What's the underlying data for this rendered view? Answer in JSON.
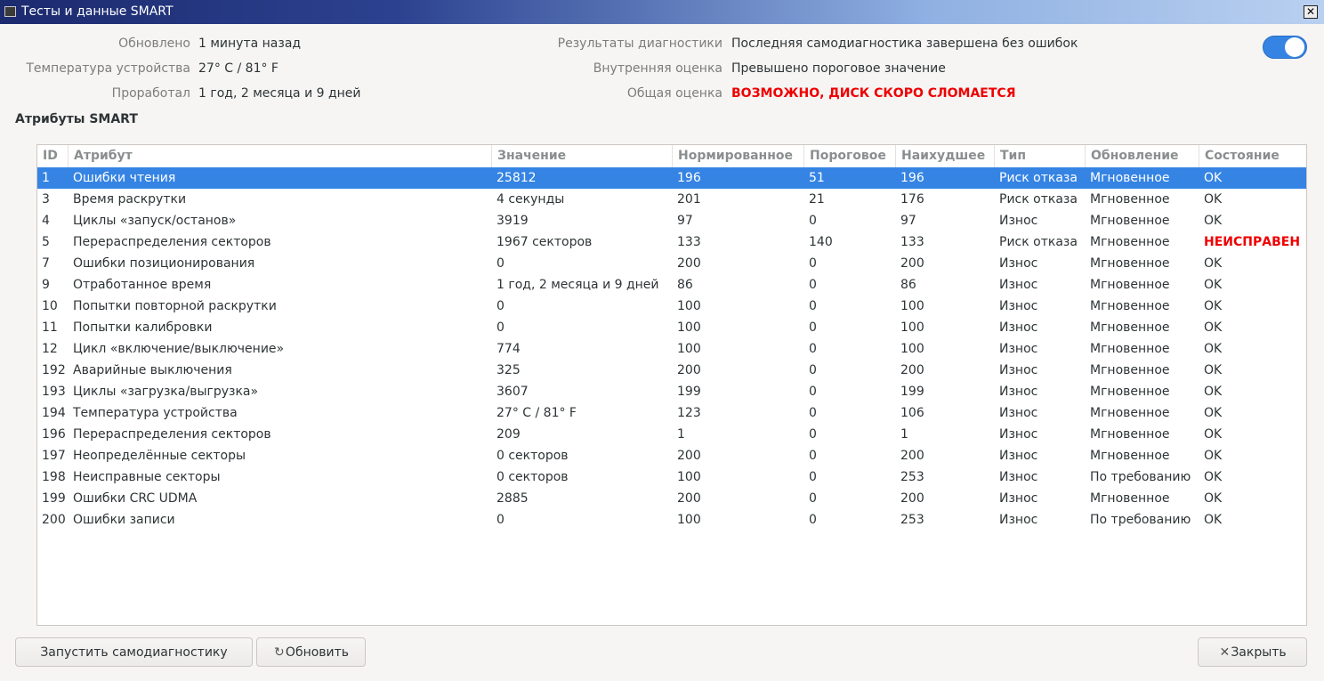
{
  "window": {
    "title": "Тесты и данные SMART",
    "close_glyph": "✕"
  },
  "info": {
    "updated_label": "Обновлено",
    "updated_value": "1 минута назад",
    "temp_label": "Температура устройства",
    "temp_value": "27° C / 81° F",
    "powered_label": "Проработал",
    "powered_value": "1 год, 2 месяца и 9 дней",
    "diag_label": "Результаты диагностики",
    "diag_value": "Последняя самодиагностика завершена без ошибок",
    "internal_label": "Внутренняя оценка",
    "internal_value": "Превышено пороговое значение",
    "overall_label": "Общая оценка",
    "overall_value": "ВОЗМОЖНО, ДИСК СКОРО СЛОМАЕТСЯ"
  },
  "smart_enabled": true,
  "section_title": "Атрибуты SMART",
  "table": {
    "headers": [
      "ID",
      "Атрибут",
      "Значение",
      "Нормированное",
      "Пороговое",
      "Наихудшее",
      "Тип",
      "Обновление",
      "Состояние"
    ],
    "rows": [
      [
        "1",
        "Ошибки чтения",
        "25812",
        "196",
        "51",
        "196",
        "Риск отказа",
        "Мгновенное",
        "OK"
      ],
      [
        "3",
        "Время раскрутки",
        "4 секунды",
        "201",
        "21",
        "176",
        "Риск отказа",
        "Мгновенное",
        "OK"
      ],
      [
        "4",
        "Циклы «запуск/останов»",
        "3919",
        "97",
        "0",
        "97",
        "Износ",
        "Мгновенное",
        "OK"
      ],
      [
        "5",
        "Перераспределения секторов",
        "1967 секторов",
        "133",
        "140",
        "133",
        "Риск отказа",
        "Мгновенное",
        "НЕИСПРАВЕН"
      ],
      [
        "7",
        "Ошибки позиционирования",
        "0",
        "200",
        "0",
        "200",
        "Износ",
        "Мгновенное",
        "OK"
      ],
      [
        "9",
        "Отработанное время",
        "1 год, 2 месяца и 9 дней",
        "86",
        "0",
        "86",
        "Износ",
        "Мгновенное",
        "OK"
      ],
      [
        "10",
        "Попытки повторной раскрутки",
        "0",
        "100",
        "0",
        "100",
        "Износ",
        "Мгновенное",
        "OK"
      ],
      [
        "11",
        "Попытки калибровки",
        "0",
        "100",
        "0",
        "100",
        "Износ",
        "Мгновенное",
        "OK"
      ],
      [
        "12",
        "Цикл «включение/выключение»",
        "774",
        "100",
        "0",
        "100",
        "Износ",
        "Мгновенное",
        "OK"
      ],
      [
        "192",
        "Аварийные выключения",
        "325",
        "200",
        "0",
        "200",
        "Износ",
        "Мгновенное",
        "OK"
      ],
      [
        "193",
        "Циклы «загрузка/выгрузка»",
        "3607",
        "199",
        "0",
        "199",
        "Износ",
        "Мгновенное",
        "OK"
      ],
      [
        "194",
        "Температура устройства",
        "27° C / 81° F",
        "123",
        "0",
        "106",
        "Износ",
        "Мгновенное",
        "OK"
      ],
      [
        "196",
        "Перераспределения секторов",
        "209",
        "1",
        "0",
        "1",
        "Износ",
        "Мгновенное",
        "OK"
      ],
      [
        "197",
        "Неопределённые секторы",
        "0 секторов",
        "200",
        "0",
        "200",
        "Износ",
        "Мгновенное",
        "OK"
      ],
      [
        "198",
        "Неисправные секторы",
        "0 секторов",
        "100",
        "0",
        "253",
        "Износ",
        "По требованию",
        "OK"
      ],
      [
        "199",
        "Ошибки CRC UDMA",
        "2885",
        "200",
        "0",
        "200",
        "Износ",
        "Мгновенное",
        "OK"
      ],
      [
        "200",
        "Ошибки записи",
        "0",
        "100",
        "0",
        "253",
        "Износ",
        "По требованию",
        "OK"
      ]
    ],
    "selected_row": 0,
    "failed_status": "НЕИСПРАВЕН"
  },
  "buttons": {
    "self_test": "Запустить самодиагностику",
    "refresh": "Обновить",
    "refresh_icon": "refresh-icon",
    "close": "Закрыть",
    "close_icon": "close-icon"
  },
  "colors": {
    "accent": "#3584e4",
    "danger": "#ef0000"
  }
}
